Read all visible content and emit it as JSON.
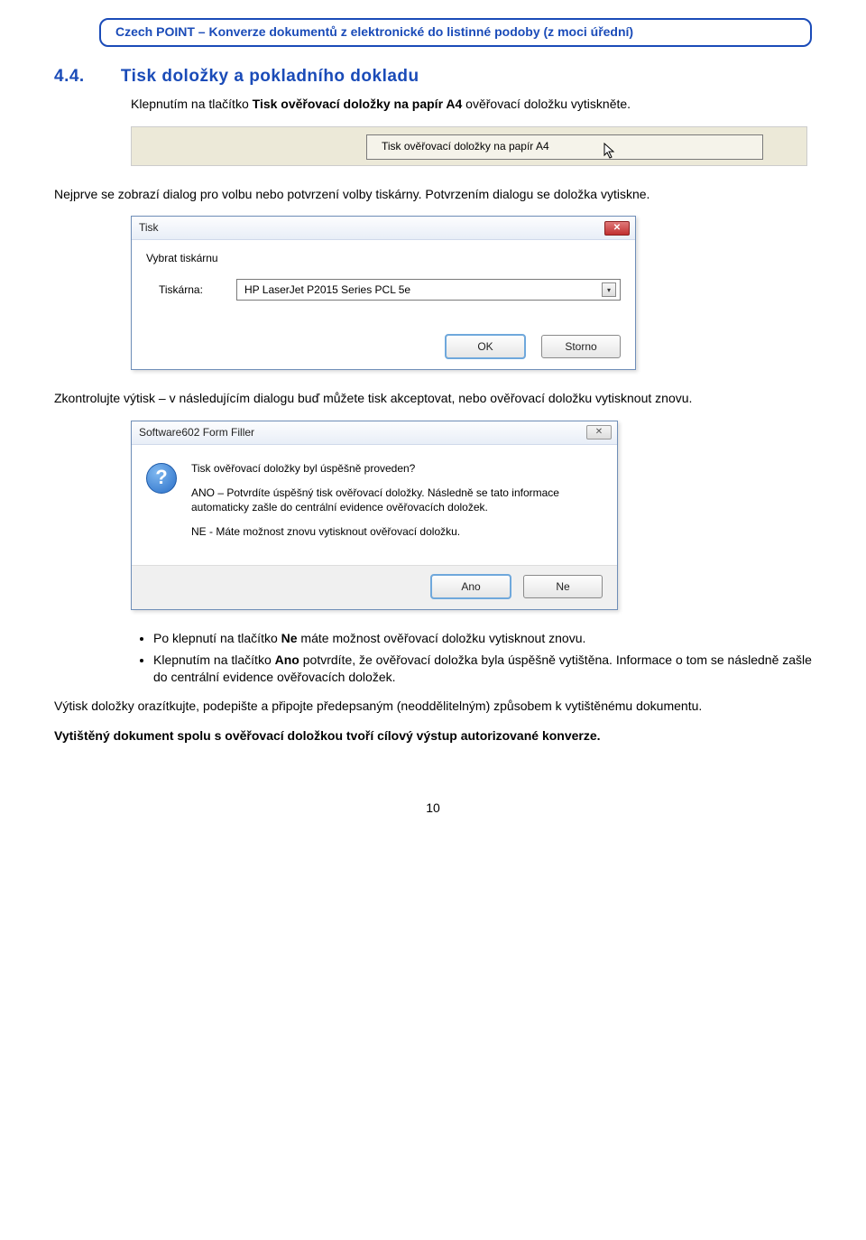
{
  "header": "Czech POINT – Konverze dokumentů z elektronické do listinné podoby (z moci úřední)",
  "section": {
    "num": "4.4.",
    "title": "Tisk doložky a pokladního dokladu"
  },
  "p1_a": "Klepnutím na tlačítko ",
  "p1_b": "Tisk ověřovací doložky na papír A4",
  "p1_c": " ověřovací doložku vytiskněte.",
  "fig1": {
    "button_label": "Tisk ověřovací doložky na papír A4"
  },
  "p2": "Nejprve se zobrazí dialog pro volbu nebo potvrzení volby tiskárny. Potvrzením dialogu se doložka vytiskne.",
  "dlg1": {
    "title": "Tisk",
    "group_label": "Vybrat tiskárnu",
    "field_label": "Tiskárna:",
    "printer": "HP LaserJet P2015 Series PCL 5e",
    "ok": "OK",
    "cancel": "Storno"
  },
  "p3": "Zkontrolujte výtisk – v následujícím dialogu buď můžete tisk akceptovat, nebo ověřovací doložku vytisknout znovu.",
  "dlg2": {
    "title": "Software602 Form Filler",
    "line1": "Tisk ověřovací doložky byl úspěšně proveden?",
    "line2": "ANO – Potvrdíte úspěšný tisk ověřovací doložky. Následně se tato informace automaticky zašle do centrální evidence ověřovacích doložek.",
    "line3": "NE - Máte možnost znovu vytisknout ověřovací doložku.",
    "yes": "Ano",
    "no": "Ne"
  },
  "bullets": [
    {
      "a": "Po klepnutí na tlačítko ",
      "b": "Ne",
      "c": " máte možnost ověřovací doložku vytisknout znovu."
    },
    {
      "a": "Klepnutím na tlačítko ",
      "b": "Ano",
      "c": " potvrdíte, že ověřovací doložka byla úspěšně vytištěna. Informace o tom se následně zašle do centrální evidence ověřovacích doložek."
    }
  ],
  "p4": "Výtisk doložky orazítkujte, podepište a připojte předepsaným (neoddělitelným) způsobem k vytištěnému dokumentu.",
  "p5": "Vytištěný dokument spolu s ověřovací doložkou tvoří cílový výstup autorizované konverze.",
  "page_num": "10"
}
